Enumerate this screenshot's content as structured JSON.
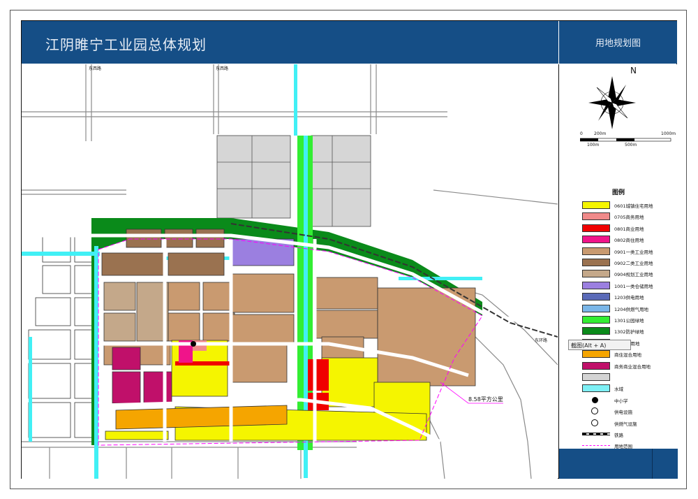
{
  "header": {
    "title": "江阴睢宁工业园总体规划",
    "panel_title": "用地规划图"
  },
  "compass": {
    "north_label": "N"
  },
  "scale": {
    "top_labels": [
      "0",
      "200m",
      "1000m"
    ],
    "bottom_labels": [
      "100m",
      "500m"
    ]
  },
  "legend": {
    "title": "图例",
    "items": [
      {
        "label": "0601城镇住宅用地",
        "color": "#f5f500"
      },
      {
        "label": "0705商务用地",
        "color": "#f08a8a"
      },
      {
        "label": "0801商业用地",
        "color": "#f00000"
      },
      {
        "label": "0802商住用地",
        "color": "#f0148a"
      },
      {
        "label": "0901一类工业用地",
        "color": "#c99a70"
      },
      {
        "label": "0902二类工业用地",
        "color": "#9a7250"
      },
      {
        "label": "0904规划工业用地",
        "color": "#c4a88a"
      },
      {
        "label": "1001一类仓储用地",
        "color": "#9b7fe0"
      },
      {
        "label": "1203供电用地",
        "color": "#5a6ab8"
      },
      {
        "label": "1204供燃气用地",
        "color": "#7ab6e8"
      },
      {
        "label": "1301公园绿地",
        "color": "#33ee33"
      },
      {
        "label": "1302防护绿地",
        "color": "#0a8a1a"
      },
      {
        "label": "14 弹性用地",
        "color": "#e2f5c8"
      },
      {
        "label": "商住混合用地",
        "color": "#f5a500"
      },
      {
        "label": "商务商业混合用地",
        "color": "#c0106a"
      },
      {
        "label": "",
        "color": "#d4d4d4"
      },
      {
        "label": "水域",
        "color": "#7ef0f5"
      },
      {
        "label": "中小学",
        "color": "#000000"
      },
      {
        "label": "供电设施",
        "color": "#ffffff"
      },
      {
        "label": "供燃气设施",
        "color": "#ffffff"
      },
      {
        "label": "铁路",
        "color": "#ffffff"
      },
      {
        "label": "用地范围",
        "color": "#ffffff"
      }
    ]
  },
  "tooltip": {
    "text": "截图(Alt + A)"
  },
  "map": {
    "area_label": "8.58平方公里",
    "road_labels": [
      "东西路",
      "东西路",
      "东环路"
    ]
  },
  "colors": {
    "header_blue": "#154e86",
    "water": "#41f0f5",
    "green": "#0a8a1a"
  }
}
